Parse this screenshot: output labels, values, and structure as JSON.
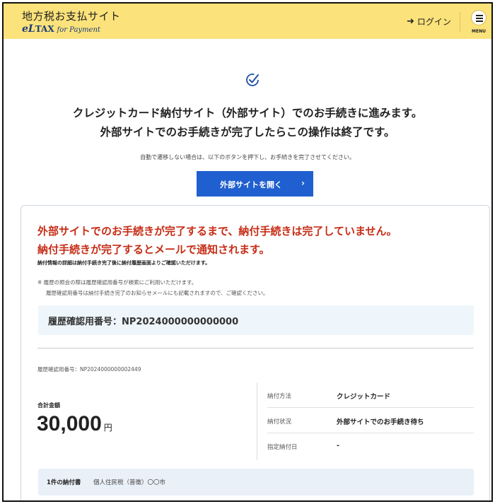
{
  "header": {
    "site_title": "地方税お支払サイト",
    "logo_el": "eL",
    "logo_tax": "TAX",
    "logo_for_payment": "for Payment",
    "login_label": "ログイン",
    "menu_label": "MENU"
  },
  "intro": {
    "lead_line1": "クレジットカード納付サイト（外部サイト）でのお手続きに進みます。",
    "lead_line2": "外部サイトでのお手続きが完了したらこの操作は終了です。",
    "note": "自動で遷移しない場合は、以下のボタンを押下し、お手続きを完了させてください。",
    "open_button": "外部サイトを開く",
    "open_button_chevron": "›"
  },
  "card": {
    "warning_line1": "外部サイトでのお手続きが完了するまで、納付手続きは完了していません。",
    "warning_line2": "納付手続きが完了するとメールで通知されます。",
    "detail_note": "納付情報の詳細は納付手続き完了後に納付履歴画面よりご確認いただけます。",
    "history_note_line1": "※ 履歴の照会の際は履歴確認用番号が検索にご利用いただけます。",
    "history_note_line2": "履歴確認用番号は納付手続き完了のお知らせメールにも記載されますので、ご確認ください。",
    "confirm_number_large": "履歴確認用番号：NP2024000000000000",
    "confirm_number_small": "履歴確認用番号：NP2024000000002449",
    "total_label": "合計金額",
    "total_amount": "30,000",
    "total_unit": "円",
    "info_rows": [
      {
        "label": "納付方法",
        "value": "クレジットカード"
      },
      {
        "label": "納付状況",
        "value": "外部サイトでのお手続き待ち"
      },
      {
        "label": "指定納付日",
        "value": "-"
      }
    ],
    "bill_count": "1件の納付書",
    "bill_detail": "個人住民税（普徴）〇〇市"
  },
  "colors": {
    "header_bg": "#fbe27a",
    "primary_button": "#1f5fcf",
    "warning_text": "#c62d16",
    "confirm_box_bg": "#eef6fb"
  }
}
